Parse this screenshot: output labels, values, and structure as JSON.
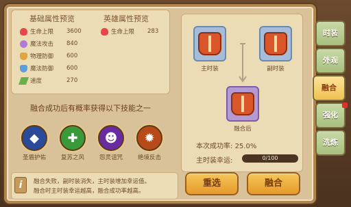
{
  "stats": {
    "base_title": "基础属性预览",
    "hero_title": "英雄属性预览",
    "base": [
      {
        "label": "生命上限",
        "value": "3600",
        "icon": "heart-icon",
        "color": "#e8464a"
      },
      {
        "label": "魔法攻击",
        "value": "840",
        "icon": "magic-attack-icon",
        "color": "#b07ad8"
      },
      {
        "label": "物理防御",
        "value": "600",
        "icon": "physical-defense-icon",
        "color": "#e2a53a"
      },
      {
        "label": "魔法防御",
        "value": "600",
        "icon": "magic-defense-icon",
        "color": "#5aa0e0"
      },
      {
        "label": "速度",
        "value": "270",
        "icon": "speed-icon",
        "color": "#6ab04a"
      }
    ],
    "hero": [
      {
        "label": "生命上限",
        "value": "283",
        "icon": "heart-icon",
        "color": "#e8464a"
      }
    ]
  },
  "skills": {
    "title": "融合成功后有概率获得以下技能之一",
    "items": [
      {
        "label": "圣盾护佑",
        "icon": "holy-shield-icon",
        "color": "#2a4a9a"
      },
      {
        "label": "复苏之风",
        "icon": "revive-wind-icon",
        "color": "#3a9a3a"
      },
      {
        "label": "怨灵诅咒",
        "icon": "curse-icon",
        "color": "#6a2aa0"
      },
      {
        "label": "绝境反击",
        "icon": "counter-attack-icon",
        "color": "#b84a1a"
      }
    ]
  },
  "tip": {
    "line1": "融合失败，副时装消失，主时装增加幸运值。",
    "line2": "融合时主时装幸运越高，融合成功率越高。"
  },
  "merge": {
    "main_label": "主时装",
    "sub_label": "副时装",
    "result_label": "融合后",
    "success_rate_label": "本次成功率:",
    "success_rate_value": "25.0%",
    "luck_label": "主时装幸运:",
    "luck_value": "0/100",
    "luck_progress": 0
  },
  "buttons": {
    "reset": "重选",
    "merge": "融合"
  },
  "tabs": [
    {
      "label": "时装",
      "active": false
    },
    {
      "label": "外观",
      "active": false
    },
    {
      "label": "融合",
      "active": true
    },
    {
      "label": "强化",
      "active": false
    },
    {
      "label": "洗炼",
      "active": false
    }
  ]
}
